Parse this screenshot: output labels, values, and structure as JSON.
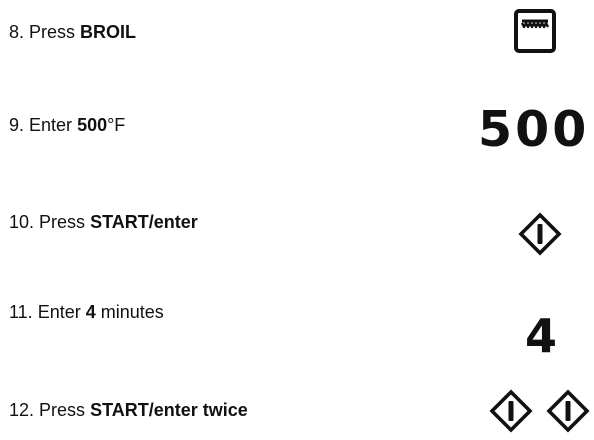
{
  "steps": [
    {
      "number": "8.",
      "pre": "Press ",
      "bold": "BROIL",
      "post": "",
      "icon": "broil-icon"
    },
    {
      "number": "9.",
      "pre": "Enter ",
      "bold": "500",
      "post": "°F",
      "display": "500"
    },
    {
      "number": "10.",
      "pre": "Press ",
      "bold": "START/enter",
      "post": "",
      "icon": "start-enter-icon"
    },
    {
      "number": "11.",
      "pre": "Enter ",
      "bold": "4",
      "post": " minutes",
      "display": "4"
    },
    {
      "number": "12.",
      "pre": "Press ",
      "bold": "START/enter twice",
      "post": "",
      "icon": "start-enter-icon"
    }
  ],
  "colors": {
    "text": "#111111",
    "background": "#ffffff"
  }
}
